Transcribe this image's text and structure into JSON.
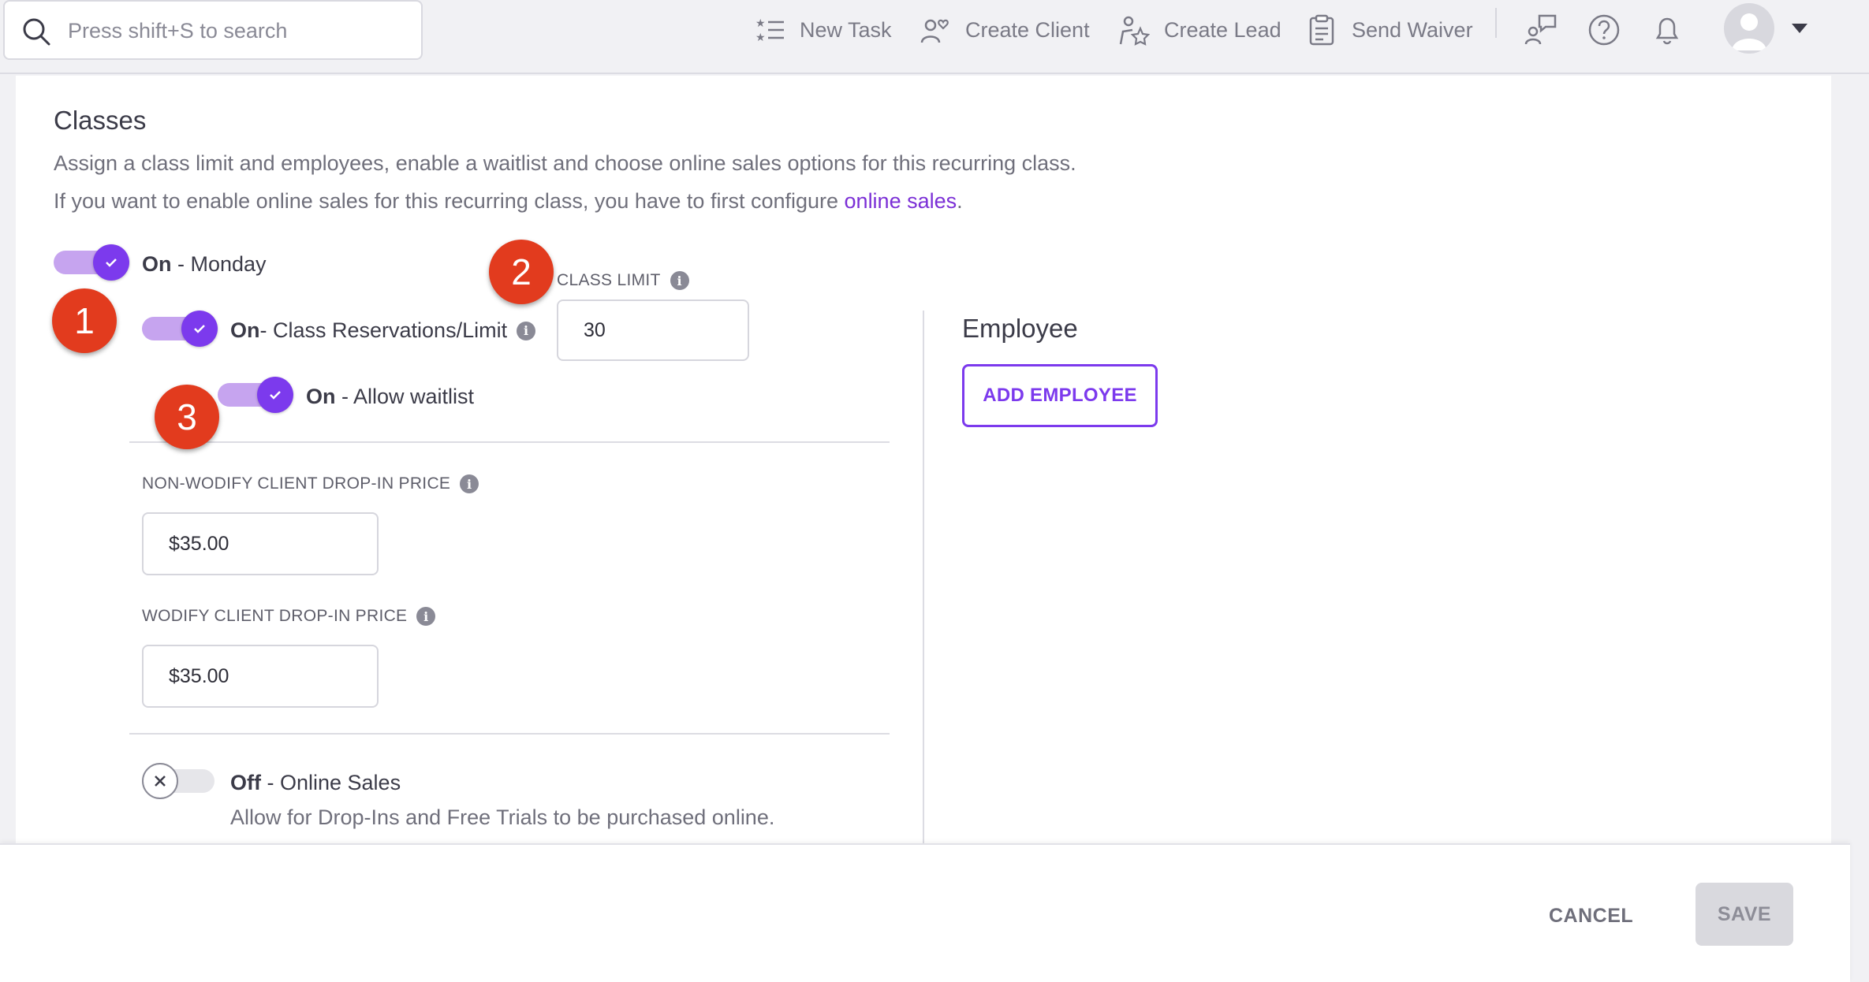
{
  "search": {
    "placeholder": "Press shift+S to search"
  },
  "nav": {
    "new_task": "New Task",
    "create_client": "Create Client",
    "create_lead": "Create Lead",
    "send_waiver": "Send Waiver"
  },
  "classes": {
    "title": "Classes",
    "desc1": "Assign a class limit and employees, enable a waitlist and choose online sales options for this recurring class.",
    "desc2_prefix": "If you want to enable online sales for this recurring class, you have to first configure ",
    "desc2_link": "online sales",
    "desc2_suffix": "."
  },
  "toggles": {
    "monday": {
      "state": "On",
      "label": " - Monday"
    },
    "reservations": {
      "state": "On",
      "label": " - Class Reservations/Limit"
    },
    "waitlist": {
      "state": "On",
      "label": " - Allow waitlist"
    },
    "online_sales": {
      "state": "Off",
      "label": " - Online Sales",
      "help": "Allow for Drop-Ins and Free Trials to be purchased online."
    }
  },
  "class_limit": {
    "label": "CLASS LIMIT",
    "value": "30"
  },
  "prices": {
    "non_wodify_label": "NON-WODIFY CLIENT DROP-IN PRICE",
    "non_wodify_value": "$35.00",
    "wodify_label": "WODIFY CLIENT DROP-IN PRICE",
    "wodify_value": "$35.00"
  },
  "employee": {
    "title": "Employee",
    "add_button": "ADD EMPLOYEE"
  },
  "badges": {
    "one": "1",
    "two": "2",
    "three": "3",
    "color": "#e23b1e"
  },
  "footer": {
    "cancel": "CANCEL",
    "save": "SAVE"
  },
  "colors": {
    "accent": "#7c3aed",
    "link": "#7b2fd6"
  }
}
